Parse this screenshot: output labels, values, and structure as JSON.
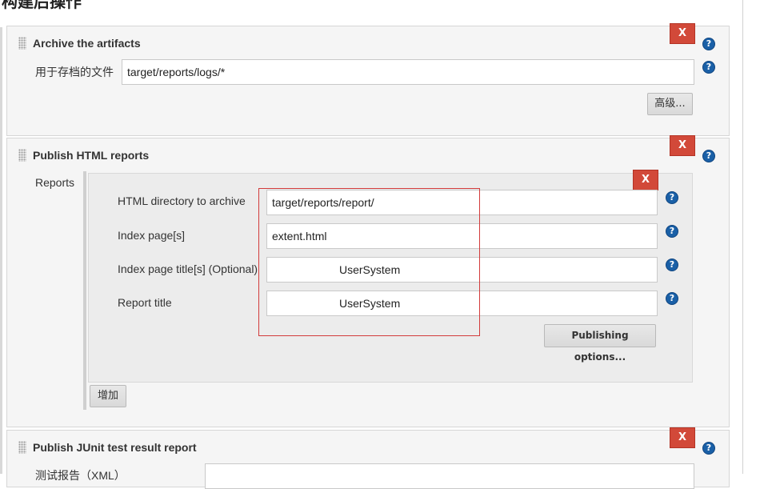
{
  "page": {
    "title": "构建后操作"
  },
  "archive": {
    "title": "Archive the artifacts",
    "files_label": "用于存档的文件",
    "files_value": "target/reports/logs/*",
    "advanced_label": "高级...",
    "delete_label": "X",
    "help_glyph": "?"
  },
  "html_reports": {
    "title": "Publish HTML reports",
    "reports_label": "Reports",
    "delete_label": "X",
    "report": {
      "delete_label": "X",
      "dir_label": "HTML directory to archive",
      "dir_value": "target/reports/report/",
      "index_label": "Index page[s]",
      "index_value": "extent.html",
      "index_title_label": "Index page title[s] (Optional)",
      "index_title_value": "UserSystem",
      "report_title_label": "Report title",
      "report_title_value": "UserSystem",
      "publishing_options_label": "Publishing options..."
    },
    "add_label": "增加"
  },
  "junit": {
    "title": "Publish JUnit test result report",
    "xml_label": "测试报告（XML）",
    "delete_label": "X"
  },
  "colors": {
    "delete_button": "#d24939",
    "help_icon": "#1a60a7",
    "highlight_box": "#d23b3b",
    "section_bg": "#f5f5f5"
  }
}
